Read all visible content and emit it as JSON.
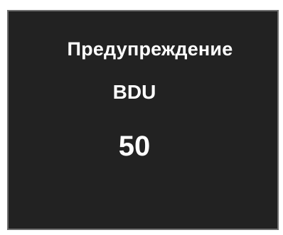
{
  "widget": {
    "heading": "Предупреждение",
    "label": "BDU",
    "value": "50",
    "colors": {
      "panel_background": "#222222",
      "panel_border": "#6f6f6f",
      "text": "#ffffff",
      "page_background": "#ffffff"
    }
  }
}
